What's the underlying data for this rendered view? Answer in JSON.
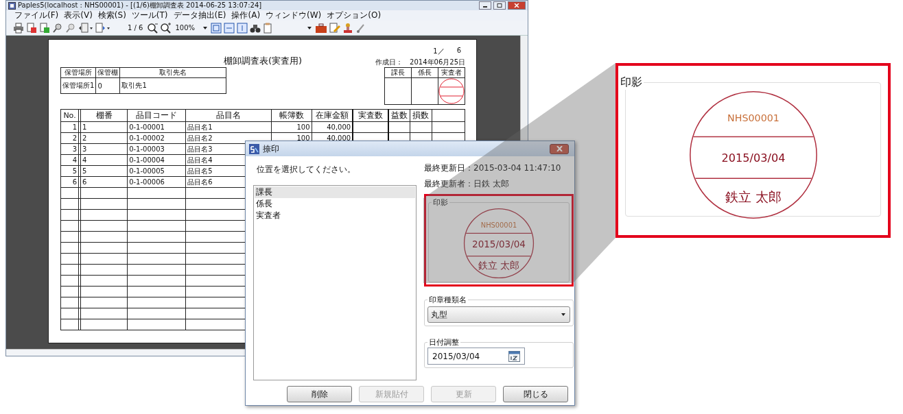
{
  "main_window": {
    "title": "Paples5(localhost : NHS00001) - [(1/6)棚卸調査表 2014-06-25 13:07:24]",
    "menu": [
      "ファイル(F)",
      "表示(V)",
      "検索(S)",
      "ツール(T)",
      "データ抽出(E)",
      "操作(A)",
      "ウィンドウ(W)",
      "オプション(O)"
    ],
    "toolbar": {
      "page": "1 / 6",
      "zoom": "100%"
    }
  },
  "report": {
    "page_no": "1／",
    "page_total": "6",
    "title": "棚卸調査表(実査用)",
    "created": "作成日：　2014年06月25日",
    "location_table": {
      "columns": [
        "保管場所",
        "保管棚",
        "取引先名"
      ],
      "values": [
        "保管場所1",
        "0",
        "取引先1"
      ]
    },
    "approvals": [
      "課長",
      "係長",
      "実査者"
    ],
    "table": {
      "columns": [
        "No.",
        "棚番",
        "品目コード",
        "品目名",
        "帳簿数",
        "在庫金額",
        "実査数",
        "益数",
        "損数"
      ],
      "rows": [
        {
          "cells": [
            "1",
            "1",
            "0-1-00001",
            "品目名1",
            "100",
            "40,000"
          ]
        },
        {
          "cells": [
            "2",
            "2",
            "0-1-00002",
            "品目名2",
            "100",
            "40,000"
          ]
        },
        {
          "cells": [
            "3",
            "3",
            "0-1-00003",
            "品目名3"
          ]
        },
        {
          "cells": [
            "4",
            "4",
            "0-1-00004",
            "品目名4"
          ]
        },
        {
          "cells": [
            "5",
            "5",
            "0-1-00005",
            "品目名5"
          ]
        },
        {
          "cells": [
            "6",
            "6",
            "0-1-00006",
            "品目名6"
          ]
        }
      ]
    }
  },
  "dialog": {
    "title": "捺印",
    "prompt": "位置を選択してください。",
    "positions": [
      {
        "label": "課長",
        "selected": true
      },
      {
        "label": "係長",
        "selected": false
      },
      {
        "label": "実査者",
        "selected": false
      }
    ],
    "last_updated": "最終更新日：2015-03-04 11:47:10",
    "last_updater": "最終更新者：日鉄 太郎",
    "stamp_group": {
      "label": "印影",
      "highlighted": true,
      "stamp": [
        "NHS00001",
        "2015/03/04",
        "鉄立 太郎"
      ]
    },
    "seal_type": {
      "label": "印章種類名",
      "value": "丸型"
    },
    "date_adjust": {
      "label": "日付調整",
      "value": "2015/03/04"
    },
    "buttons": [
      {
        "label": "削除",
        "disabled": false
      },
      {
        "label": "新規貼付",
        "disabled": true
      },
      {
        "label": "更新",
        "disabled": true
      },
      {
        "label": "閉じる",
        "disabled": false
      }
    ]
  },
  "callout": {
    "label": "印影",
    "stamp": [
      "NHS00001",
      "2015/03/04",
      "鉄立 太郎"
    ]
  }
}
